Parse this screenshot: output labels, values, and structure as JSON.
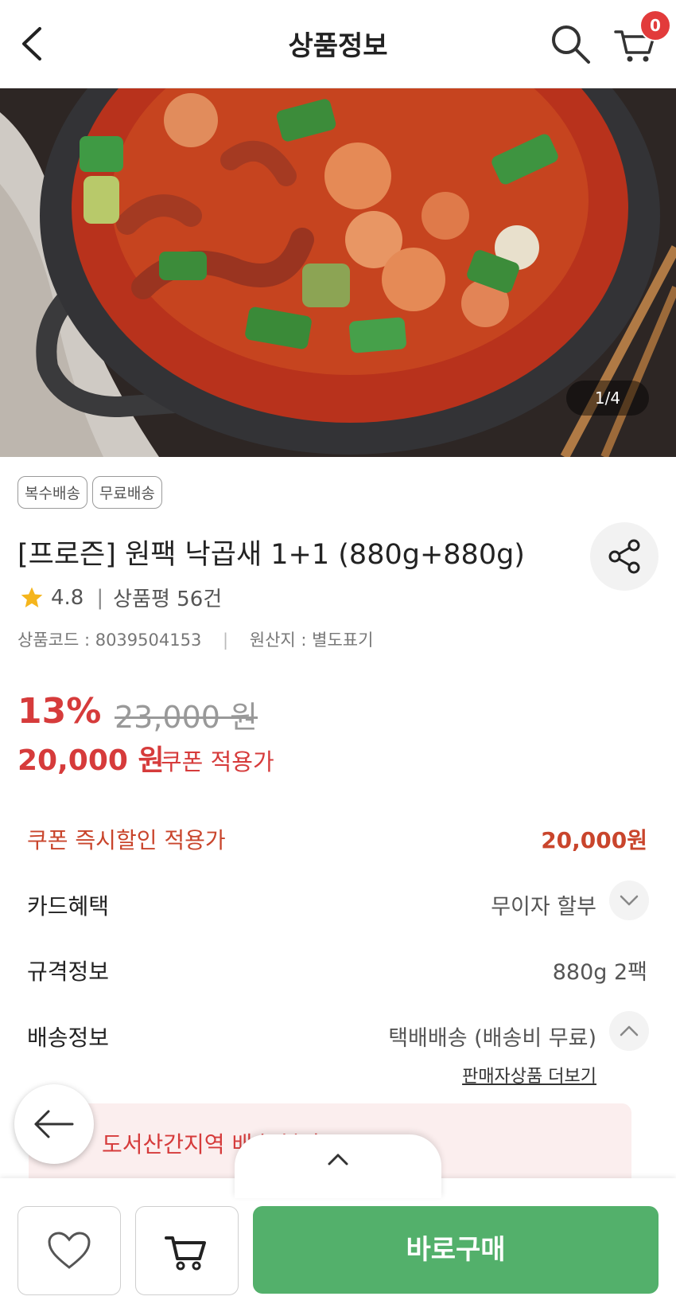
{
  "header": {
    "title": "상품정보",
    "cart_count": "0",
    "icons": [
      "back-arrow-icon",
      "search-icon",
      "cart-icon"
    ]
  },
  "gallery": {
    "counter": "1/4"
  },
  "product": {
    "tags": [
      "복수배송",
      "무료배송"
    ],
    "title": "[프로즌] 원팩 낙곱새 1+1 (880g+880g)",
    "rating": "4.8",
    "review_count": "상품평 56건",
    "product_code": "상품코드 : 8039504153",
    "origin": "원산지 : 별도표기"
  },
  "price": {
    "discount_rate": "13%",
    "original_price": "23,000 원",
    "sale_price": "20,000 원",
    "coupon_label": "쿠폰 적용가"
  },
  "info_rows": {
    "coupon_label": "쿠폰 즉시할인 적용가",
    "coupon_value": "20,000원",
    "card_label": "카드혜택",
    "card_value": "무이자 할부",
    "spec_label": "규격정보",
    "spec_value": "880g 2팩",
    "shipping_label": "배송정보",
    "shipping_value": "택배배송  (배송비 무료)",
    "seller_link": "판매자상품 더보기"
  },
  "notice": {
    "text": "도서산간지역 배송 불가"
  },
  "bottom_bar": {
    "buy_label": "바로구매",
    "icons": [
      "heart-icon",
      "cart-icon"
    ]
  },
  "colors": {
    "accent_red": "#d63b3b",
    "coupon_orange": "#c9452c",
    "buy_green": "#53b06b",
    "badge_red": "#e23b3b"
  }
}
